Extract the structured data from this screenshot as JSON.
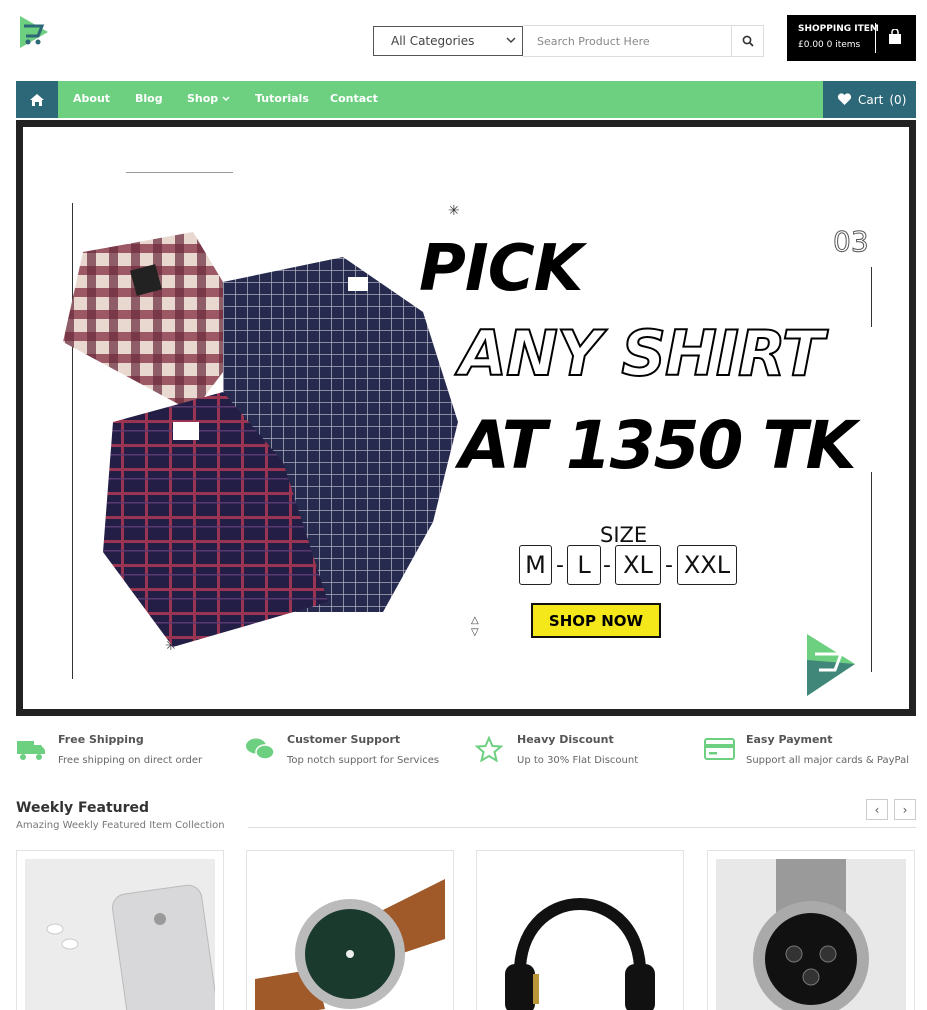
{
  "header": {
    "logo": "store-logo",
    "category_select": "All Categories",
    "search_placeholder": "Search Product Here",
    "cart_box": {
      "title": "SHOPPING ITEM",
      "summary": "£0.00 0 items"
    }
  },
  "nav": {
    "items": [
      "About",
      "Blog",
      "Shop",
      "Tutorials",
      "Contact"
    ],
    "cart_label": "Cart",
    "cart_count": "(0)"
  },
  "hero": {
    "line1": "PICK",
    "line2": "ANY SHIRT",
    "line3": "AT 1350 TK",
    "slide_number": "03",
    "size_label": "SIZE",
    "sizes": [
      "M",
      "L",
      "XL",
      "XXL"
    ],
    "cta": "SHOP NOW"
  },
  "features": [
    {
      "title": "Free Shipping",
      "desc": "Free shipping on direct order",
      "icon": "truck-icon"
    },
    {
      "title": "Customer Support",
      "desc": "Top notch support for Services",
      "icon": "chat-icon"
    },
    {
      "title": "Heavy Discount",
      "desc": "Up to 30% Flat Discount",
      "icon": "star-icon"
    },
    {
      "title": "Easy Payment",
      "desc": "Support all major cards & PayPal",
      "icon": "credit-card-icon"
    }
  ],
  "weekly": {
    "title": "Weekly Featured",
    "subtitle": "Amazing Weekly Featured Item Collection",
    "products": [
      {
        "image": "iphone-airpods"
      },
      {
        "image": "green-dial-watch"
      },
      {
        "image": "headphones"
      },
      {
        "image": "chronograph-watch"
      }
    ]
  },
  "colors": {
    "accent": "#6dd080",
    "nav_dark": "#2d6878",
    "cta": "#f4e81a"
  }
}
